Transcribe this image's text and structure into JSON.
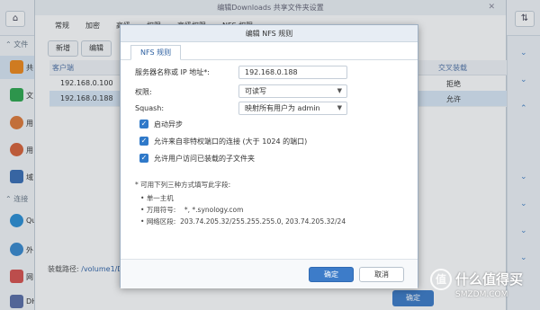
{
  "control_panel": {
    "sidebar": {
      "sections": [
        "文件",
        "连接"
      ],
      "items": [
        {
          "label": "共",
          "icon": "share-folder-icon",
          "color": "#f08a1c"
        },
        {
          "label": "文",
          "icon": "file-services-icon",
          "color": "#2fa84f"
        },
        {
          "label": "用",
          "icon": "user-icon",
          "color": "#e07b3a"
        },
        {
          "label": "用",
          "icon": "group-icon",
          "color": "#d9643a"
        },
        {
          "label": "域",
          "icon": "domain-icon",
          "color": "#3b6fb5"
        },
        {
          "label": "Qu",
          "icon": "quickconnect-icon",
          "color": "#2b8fd6"
        },
        {
          "label": "外",
          "icon": "external-access-icon",
          "color": "#3a8bd0"
        },
        {
          "label": "网",
          "icon": "network-icon",
          "color": "#d9534f"
        },
        {
          "label": "DH",
          "icon": "dhcp-icon",
          "color": "#5b6fa8"
        }
      ]
    }
  },
  "shared_folder_window": {
    "title": "编辑Downloads 共享文件夹设置",
    "tabs": [
      "常规",
      "加密",
      "高级",
      "权限",
      "高级权限",
      "NFS 权限"
    ],
    "buttons": {
      "add": "新增",
      "edit": "编辑"
    },
    "columns": [
      "客户端",
      "交叉装载"
    ],
    "rows": [
      {
        "client": "192.168.0.100",
        "cross_mount": "拒绝",
        "selected": false
      },
      {
        "client": "192.168.0.188",
        "cross_mount": "允许",
        "selected": true
      }
    ],
    "mount_path_label": "装载路径:",
    "mount_path_value": "/volume1/D",
    "ok_label": "确定"
  },
  "nfs_dialog": {
    "title": "编辑 NFS 规则",
    "tab": "NFS 规则",
    "fields": {
      "hostname_label": "服务器名称或 IP 地址*:",
      "hostname_value": "192.168.0.188",
      "privilege_label": "权限:",
      "privilege_value": "可读写",
      "squash_label": "Squash:",
      "squash_value": "映射所有用户为 admin"
    },
    "checkboxes": [
      {
        "label": "启动异步",
        "checked": true
      },
      {
        "label": "允许来自非特权端口的连接 (大于 1024 的端口)",
        "checked": true
      },
      {
        "label": "允许用户访问已装载的子文件夹",
        "checked": true
      }
    ],
    "note_title": "* 可用下列三种方式填写此字段:",
    "note_items": [
      {
        "label": "单一主机",
        "value": ""
      },
      {
        "label": "万用符号:",
        "value": "*, *.synology.com"
      },
      {
        "label": "网络区段:",
        "value": "203.74.205.32/255.255.255.0, 203.74.205.32/24"
      }
    ],
    "ok_label": "确定",
    "cancel_label": "取消"
  },
  "watermark": {
    "logo": "值",
    "text": "什么值得买",
    "sub": "SMZDM.COM"
  }
}
